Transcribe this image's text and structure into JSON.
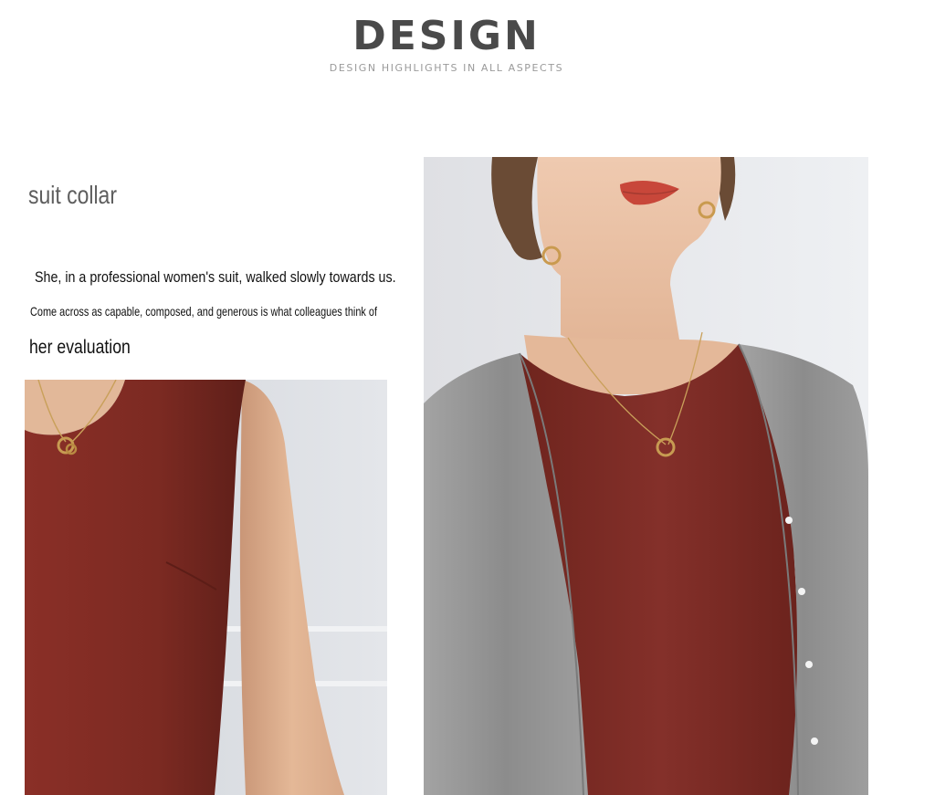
{
  "header": {
    "title": "DESIGN",
    "subtitle": "DESIGN HIGHLIGHTS IN ALL ASPECTS"
  },
  "section": {
    "title": "suit collar",
    "line1": "She, in a professional women's suit, walked slowly towards us.",
    "line2": "Come across as capable, composed, and generous is what colleagues think of",
    "line3": "her evaluation"
  },
  "colors": {
    "dress": "#7e2a22",
    "cardigan": "#8f8f8f",
    "skin": "#e6c0a4",
    "background": "#ffffff"
  }
}
